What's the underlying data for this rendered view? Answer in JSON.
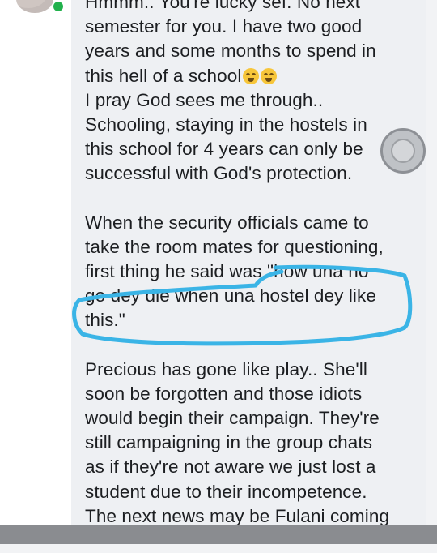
{
  "comment": {
    "paragraph_1": [
      "Hmmm.. You're lucky sef. No next",
      "semester for you. I have two good",
      "years and some months to spend in",
      "this hell of a school",
      "I pray God sees me through..",
      "Schooling, staying in the hostels in",
      "this school for 4 years can only be",
      "successful with God's protection."
    ],
    "paragraph_2": [
      "When the security officials came to",
      "take the room mates for questioning,",
      "first thing he said was \"how una no",
      "go dey die when una hostel dey like",
      "this.\""
    ],
    "paragraph_3": [
      "Precious has gone like play.. She'll",
      "soon be forgotten and those idiots",
      "would begin their campaign. They're",
      "still campaigning in the group chats",
      "as if they're not aware we just lost a",
      "student due to their incompetence.",
      "The next news may be Fulani coming"
    ],
    "emoji_name": "loudly-crying-face-emoji",
    "emoji_count": 2
  },
  "colors": {
    "highlight_stroke": "#3ab4e6",
    "online_dot": "#22b14c",
    "text": "#1c1e21"
  }
}
